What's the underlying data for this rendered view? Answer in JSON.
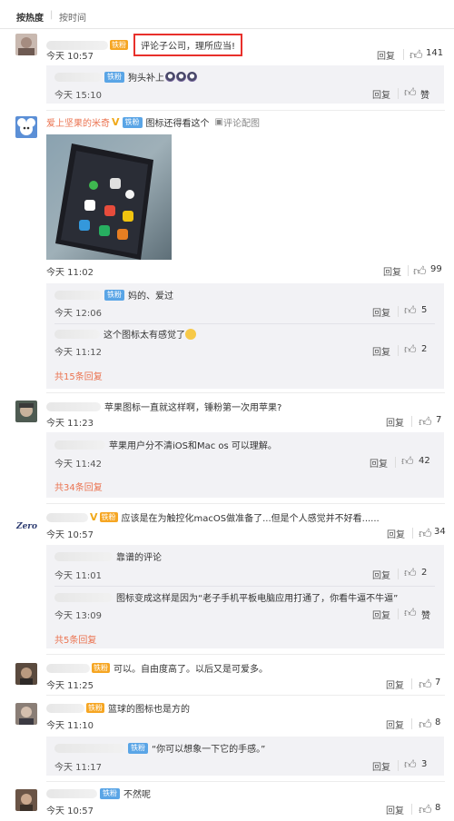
{
  "sort": {
    "hot": "按热度",
    "separator": "|",
    "time": "按时间"
  },
  "labels": {
    "reply": "回复",
    "tie_badge": "铁粉",
    "fan_badge": "铁粉",
    "v_badge": "V"
  },
  "comments": [
    {
      "text": "评论子公司，理所应当!",
      "time": "今天 10:57",
      "likes": "141",
      "replies": [
        {
          "text": "狗头补上",
          "time": "今天 15:10",
          "likes": "赞"
        }
      ]
    },
    {
      "username": "爱上坚果的米奇",
      "text": "图标还得看这个",
      "image_link": "评论配图",
      "time": "今天 11:02",
      "likes": "99",
      "replies": [
        {
          "text": "妈的、爱过",
          "time": "今天 12:06",
          "likes": "5"
        },
        {
          "text": "这个图标太有感觉了",
          "time": "今天 11:12",
          "likes": "2"
        }
      ],
      "more": "共15条回复"
    },
    {
      "text": "苹果图标一直就这样啊，锤粉第一次用苹果?",
      "time": "今天 11:23",
      "likes": "7",
      "replies": [
        {
          "text": "苹果用户分不清iOS和Mac os   可以理解。",
          "time": "今天 11:42",
          "likes": "42"
        }
      ],
      "more": "共34条回复"
    },
    {
      "avatar_text": "Zero",
      "text": "应该是在为触控化macOS做准备了...但是个人感觉并不好看......",
      "time": "今天 10:57",
      "likes": "34",
      "replies": [
        {
          "text": "靠谱的评论",
          "time": "今天 11:01",
          "likes": "2"
        },
        {
          "text": "图标变成这样是因为“老子手机平板电脑应用打通了，你看牛逼不牛逼”",
          "time": "今天 13:09",
          "likes": "赞"
        }
      ],
      "more": "共5条回复"
    },
    {
      "text": "可以。自由度高了。以后又是可爱多。",
      "time": "今天 11:25",
      "likes": "7"
    },
    {
      "text": "篮球的图标也是方的",
      "time": "今天 11:10",
      "likes": "8",
      "replies": [
        {
          "text": "“你可以想象一下它的手感。”",
          "time": "今天 11:17",
          "likes": "3"
        }
      ]
    },
    {
      "text": "不然呢",
      "time": "今天 10:57",
      "likes": "8"
    }
  ]
}
